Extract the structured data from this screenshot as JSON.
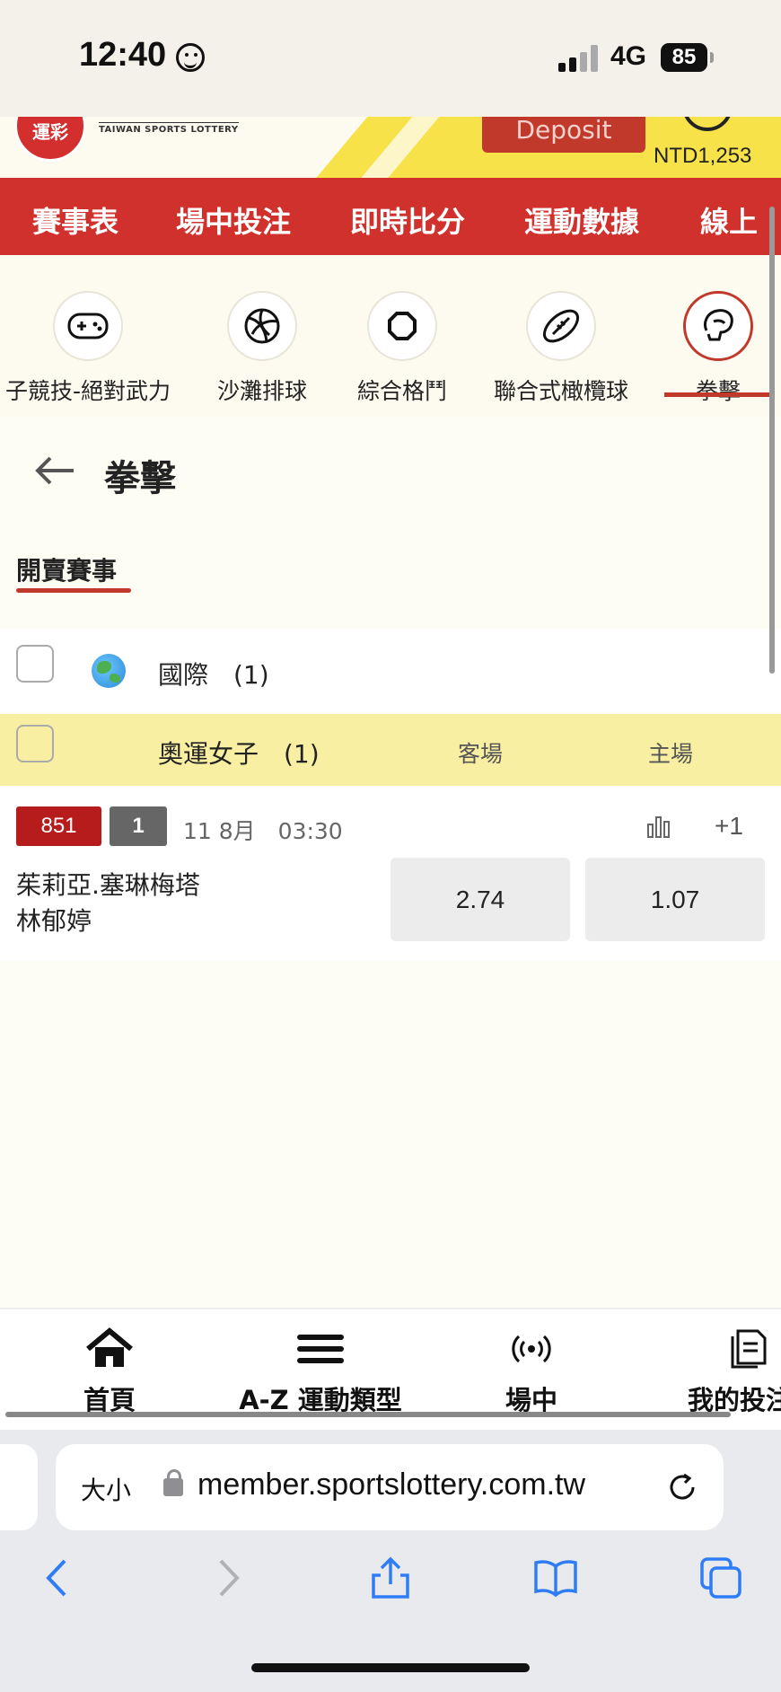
{
  "status_bar": {
    "time": "12:40",
    "network": "4G",
    "battery": "85"
  },
  "header": {
    "logo_text": "運彩",
    "brand": "TAIWAN SPORTS LOTTERY",
    "deposit_label": "Deposit",
    "balance": "NTD1,253"
  },
  "nav": {
    "items": [
      "賽事表",
      "場中投注",
      "即時比分",
      "運動數據",
      "線上"
    ]
  },
  "categories": [
    {
      "label": "子競技-絕對武力",
      "icon": "gamepad-icon"
    },
    {
      "label": "沙灘排球",
      "icon": "volleyball-icon"
    },
    {
      "label": "綜合格鬥",
      "icon": "octagon-icon"
    },
    {
      "label": "聯合式橄欖球",
      "icon": "rugby-ball-icon"
    },
    {
      "label": "拳擊",
      "icon": "boxing-glove-icon",
      "active": true
    }
  ],
  "page": {
    "title": "拳擊",
    "tab": "開賣賽事"
  },
  "region": {
    "label": "國際　(1)"
  },
  "league": {
    "label": "奧運女子　(1)",
    "col_away": "客場",
    "col_home": "主場"
  },
  "match": {
    "id": "851",
    "num": "1",
    "date": "11 8月　03:30",
    "more": "+1",
    "team1": "茱莉亞.塞琳梅塔",
    "team2": "林郁婷",
    "odd_away": "2.74",
    "odd_home": "1.07"
  },
  "tabbar": {
    "items": [
      "首頁",
      "A-Z 運動類型",
      "場中",
      "我的投注"
    ]
  },
  "browser": {
    "text_size": "大小",
    "url": "member.sportslottery.com.tw"
  },
  "colors": {
    "brand_red": "#d0312d",
    "league_yellow": "#f9efa3",
    "badge_red": "#b71c1c"
  }
}
